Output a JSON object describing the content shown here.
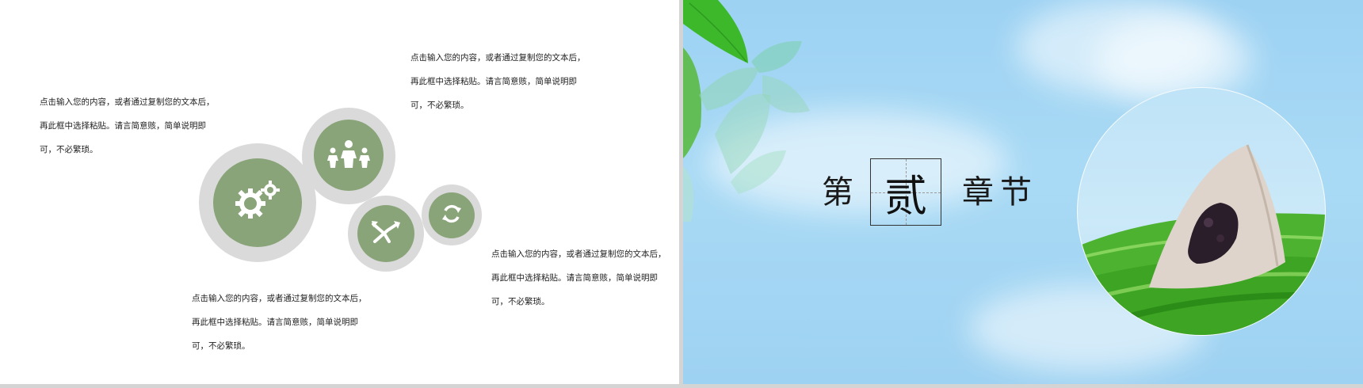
{
  "left_slide": {
    "text_blocks": [
      {
        "lines": [
          "点击输入您的内容，或者通过复制您的文本后，",
          "再此框中选择粘贴。请言简意赅，简单说明即",
          "可，不必繁琐。"
        ]
      },
      {
        "lines": [
          "点击输入您的内容，或者通过复制您的文本后，",
          "再此框中选择粘贴。请言简意赅，简单说明即",
          "可，不必繁琐。"
        ]
      },
      {
        "lines": [
          "点击输入您的内容，或者通过复制您的文本后，",
          "再此框中选择粘贴。请言简意赅，简单说明即",
          "可，不必繁琐。"
        ]
      },
      {
        "lines": [
          "点击输入您的内容，或者通过复制您的文本后，",
          "再此框中选择粘贴。请言简意赅，简单说明即",
          "可，不必繁琐。"
        ]
      }
    ],
    "icons": [
      "gears-icon",
      "family-icon",
      "crossing-arrows-icon",
      "refresh-icon"
    ],
    "colors": {
      "circle_fill": "#8aa479",
      "circle_ring": "#dadada"
    }
  },
  "right_slide": {
    "title": {
      "char1": "第",
      "hero": "贰",
      "char3": "章",
      "char4": "节"
    },
    "colors": {
      "sky": "#9dd2f3",
      "leaf": "#5cc83a"
    }
  }
}
